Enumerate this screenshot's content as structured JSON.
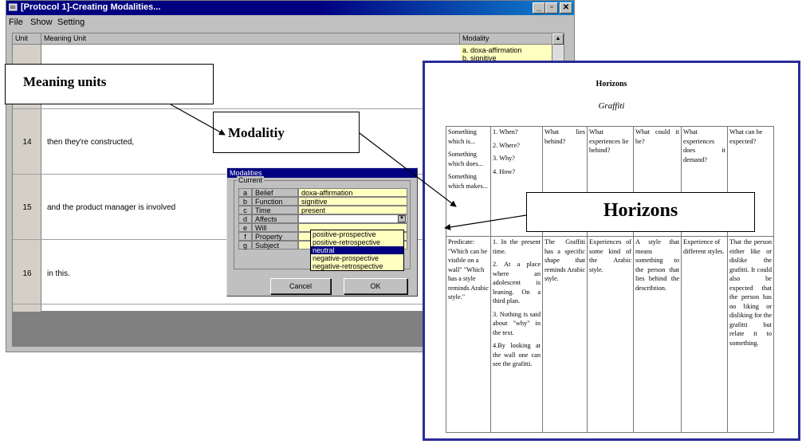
{
  "window": {
    "title": "[Protocol 1]-Creating Modalities...",
    "controls": {
      "minimize": "_",
      "maximize": "▫",
      "close": "✕"
    }
  },
  "menu": [
    "File",
    "Show",
    "Setting"
  ],
  "grid": {
    "headers": {
      "unit": "Unit",
      "meaning": "Meaning Unit",
      "modality": "Modality"
    },
    "modality_top": [
      "a. doxa-affirmation",
      "b. signitive"
    ],
    "rows": [
      {
        "unit": "14",
        "text": "then they're constructed,"
      },
      {
        "unit": "15",
        "text": "and the product manager is involved"
      },
      {
        "unit": "16",
        "text": "in this."
      }
    ]
  },
  "dialog": {
    "title": "Modalities",
    "group": "Current",
    "rows": [
      {
        "key": "a",
        "name": "Belief",
        "value": "doxa-affirmation"
      },
      {
        "key": "b",
        "name": "Function",
        "value": "signitive"
      },
      {
        "key": "c",
        "name": "Time",
        "value": "present"
      },
      {
        "key": "d",
        "name": "Affects",
        "value": ""
      },
      {
        "key": "e",
        "name": "Will",
        "value": ""
      },
      {
        "key": "f",
        "name": "Property",
        "value": ""
      },
      {
        "key": "g",
        "name": "Subject",
        "value": ""
      }
    ],
    "dropdown_options": [
      "positive-prospective",
      "positive-retrospective",
      "neutral",
      "negative-prospective",
      "negative-retrospective"
    ],
    "selected_option": "neutral",
    "cancel": "Cancel",
    "ok": "OK"
  },
  "callouts": {
    "meaning_units": "Meaning units",
    "modality": "Modalitiy",
    "horizons": "Horizons"
  },
  "doc": {
    "title": "Horizons",
    "subtitle": "Graffiti",
    "col1_head": [
      "Something which is...",
      "Something which does...",
      "Something which makes..."
    ],
    "col2_head": [
      "1. When?",
      "2. Where?",
      "3. Why?",
      "4. How?"
    ],
    "heads": [
      "What lies behind?",
      "What experiences lie behind?",
      "What could it be?",
      "What experiences does it demand?",
      "What can be expected?"
    ],
    "col1_body": "Predicate: \"Which can be visible on a wall\" \"Which has a style reminds Arabic style.\"",
    "col2_body": [
      "1. In the present time.",
      "2. At a place where an adolescent is leaning. On a third plan.",
      "3. Nothing is said about \"why\" in the text.",
      "4.By looking at the wall one can see the grafitti."
    ],
    "bodies": [
      "The Graffiti has a specific shape that reminds Arabic style.",
      "Experiences of some kind of the Arabic style.",
      "A style that means something to the person that lies behind the describtion.",
      "Experience of different styles.",
      "That the person either like or dislike the grafitti. It could also be expected that the person has no liking or disliking for the grafitti but relate it to something."
    ]
  }
}
